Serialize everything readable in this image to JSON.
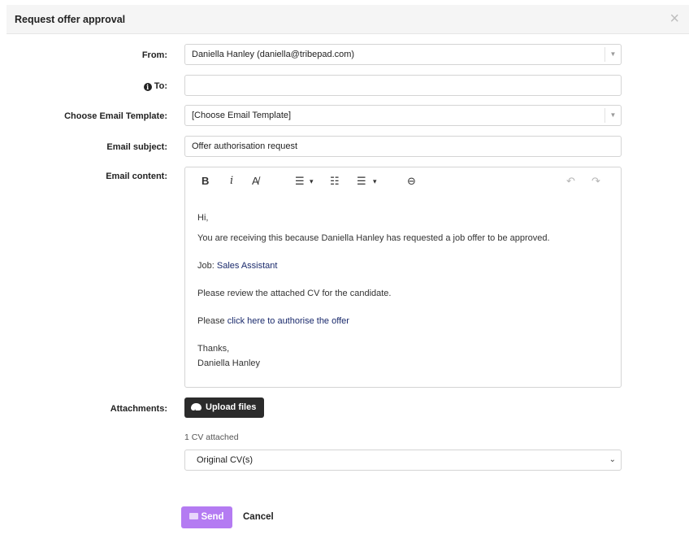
{
  "modal": {
    "title": "Request offer approval",
    "close_icon": "×"
  },
  "form": {
    "from": {
      "label": "From:",
      "value": "Daniella Hanley (daniella@tribepad.com)"
    },
    "to": {
      "label": "To:",
      "value": ""
    },
    "template": {
      "label": "Choose Email Template:",
      "value": "[Choose Email Template]"
    },
    "subject": {
      "label": "Email subject:",
      "value": "Offer authorisation request"
    },
    "content_label": "Email content:",
    "attachments_label": "Attachments:"
  },
  "editor": {
    "toolbar": {
      "bold": "B",
      "italic": "i",
      "clear_format": "A̸",
      "bullet_list": "☰",
      "dropdown": "▾",
      "numbered_list": "☷",
      "ordered_list": "☰",
      "link": "⊖",
      "undo": "↶",
      "redo": "↷"
    },
    "body": {
      "greeting": "Hi,",
      "line1": "You are receiving this because Daniella Hanley has requested a job offer to be approved.",
      "job_prefix": "Job: ",
      "job_name": "Sales Assistant",
      "review": "Please review the attached CV for the candidate.",
      "please_prefix": "Please ",
      "authorise_link": "click here to authorise the offer",
      "thanks": "Thanks,",
      "signature": "Daniella Hanley"
    }
  },
  "attachments": {
    "upload_label": "Upload files",
    "cv_count": "1 CV attached",
    "cv_select_value": "Original CV(s)"
  },
  "actions": {
    "send_label": "Send",
    "cancel_label": "Cancel"
  },
  "colors": {
    "send_bg": "#b47bf2",
    "upload_bg": "#2b2b2b",
    "link": "#1a2a6c"
  }
}
